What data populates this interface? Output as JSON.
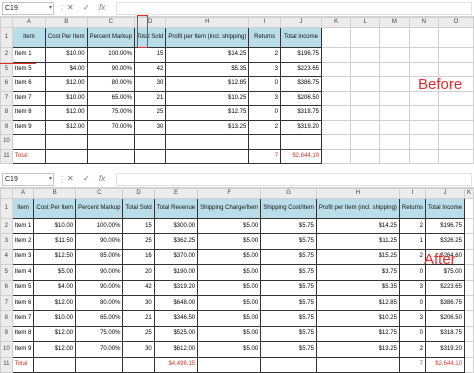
{
  "before": {
    "cell_ref": "C19",
    "columns": [
      "A",
      "B",
      "C",
      "D",
      "H",
      "I",
      "J",
      "K",
      "L",
      "M",
      "N",
      "O"
    ],
    "header": [
      "Item",
      "Cost Per Item",
      "Percent Markup",
      "Total Sold",
      "Profit per Item (incl. shipping)",
      "Returns",
      "Total Income"
    ],
    "rows": [
      {
        "rn": "2",
        "cells": [
          "Item 1",
          "$10.00",
          "100.00%",
          "15",
          "$14.25",
          "2",
          "$196.75"
        ]
      },
      {
        "rn": "5",
        "cells": [
          "Item 5",
          "$4.00",
          "90.00%",
          "42",
          "$5.35",
          "3",
          "$223.65"
        ]
      },
      {
        "rn": "6",
        "cells": [
          "Item 6",
          "$12.00",
          "80.00%",
          "30",
          "$12.85",
          "0",
          "$386.75"
        ]
      },
      {
        "rn": "7",
        "cells": [
          "Item 7",
          "$10.00",
          "65.00%",
          "21",
          "$10.25",
          "3",
          "$206.50"
        ]
      },
      {
        "rn": "8",
        "cells": [
          "Item 8",
          "$12.00",
          "75.00%",
          "25",
          "$12.75",
          "0",
          "$318.75"
        ]
      },
      {
        "rn": "9",
        "cells": [
          "Item 9",
          "$12.00",
          "70.00%",
          "30",
          "$13.25",
          "2",
          "$319.20"
        ]
      },
      {
        "rn": "10",
        "cells": [
          "",
          "",
          "",
          "",
          "",
          "",
          ""
        ]
      },
      {
        "rn": "11",
        "cells": [
          "Total",
          "",
          "",
          "",
          "",
          "7",
          "$2,644.10"
        ]
      }
    ],
    "label": "Before"
  },
  "after": {
    "cell_ref": "C19",
    "columns": [
      "A",
      "B",
      "C",
      "D",
      "E",
      "F",
      "G",
      "H",
      "I",
      "J",
      "K"
    ],
    "header": [
      "Item",
      "Cost Per Item",
      "Percent Markup",
      "Total Sold",
      "Total Revenue",
      "Shipping Charge/Item",
      "Shipping Cost/Item",
      "Profit per Item (incl. shipping)",
      "Returns",
      "Total Income"
    ],
    "rows": [
      {
        "rn": "2",
        "cells": [
          "Item 1",
          "$10.00",
          "100.00%",
          "15",
          "$300.00",
          "$5.00",
          "$5.75",
          "$14.25",
          "2",
          "$196.75"
        ]
      },
      {
        "rn": "3",
        "cells": [
          "Item 2",
          "$11.50",
          "90.00%",
          "25",
          "$362.25",
          "$5.00",
          "$5.75",
          "$11.25",
          "1",
          "$326.25"
        ]
      },
      {
        "rn": "4",
        "cells": [
          "Item 3",
          "$12.50",
          "85.00%",
          "16",
          "$370.00",
          "$5.00",
          "$5.75",
          "$15.25",
          "2",
          "$264.60"
        ]
      },
      {
        "rn": "5",
        "cells": [
          "Item 4",
          "$5.00",
          "90.00%",
          "20",
          "$190.00",
          "$5.00",
          "$5.75",
          "$3.75",
          "0",
          "$75.00"
        ]
      },
      {
        "rn": "6",
        "cells": [
          "Item 5",
          "$4.00",
          "90.00%",
          "42",
          "$319.20",
          "$5.00",
          "$5.75",
          "$5.35",
          "3",
          "$223.65"
        ]
      },
      {
        "rn": "7",
        "cells": [
          "Item 6",
          "$12.00",
          "80.00%",
          "30",
          "$648.00",
          "$5.00",
          "$5.75",
          "$12.85",
          "0",
          "$386.75"
        ]
      },
      {
        "rn": "8",
        "cells": [
          "Item 7",
          "$10.00",
          "65.00%",
          "21",
          "$346.50",
          "$5.00",
          "$5.75",
          "$10.25",
          "3",
          "$206.50"
        ]
      },
      {
        "rn": "9",
        "cells": [
          "Item 8",
          "$12.00",
          "75.00%",
          "25",
          "$525.00",
          "$5.00",
          "$5.75",
          "$12.75",
          "0",
          "$318.75"
        ]
      },
      {
        "rn": "10",
        "cells": [
          "Item 9",
          "$12.00",
          "70.00%",
          "30",
          "$612.00",
          "$5.00",
          "$5.75",
          "$13.25",
          "2",
          "$319.20"
        ]
      },
      {
        "rn": "11",
        "cells": [
          "Total",
          "",
          "",
          "",
          "$4,496.15",
          "",
          "",
          "",
          "7",
          "$2,644.10"
        ]
      }
    ],
    "label": "After"
  },
  "formula_bar": {
    "cancel": "✕",
    "enter": "✓",
    "fx": "fx"
  },
  "colors": {
    "header_fill": "#b9dde9",
    "highlight": "#e0302b"
  }
}
